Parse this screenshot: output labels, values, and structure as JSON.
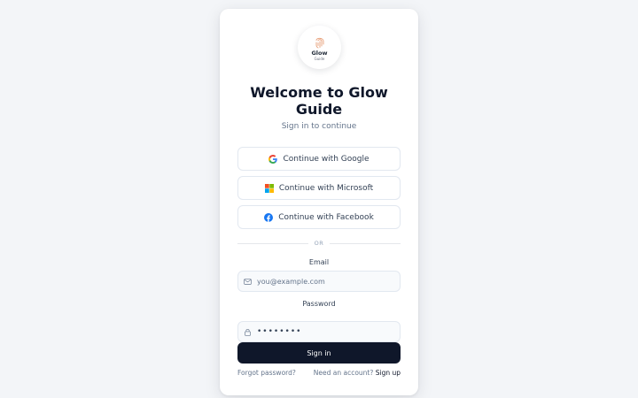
{
  "logo": {
    "title": "Glow",
    "subtitle": "Guide"
  },
  "header": {
    "title": "Welcome to Glow Guide",
    "subtitle": "Sign in to continue"
  },
  "social": {
    "google": "Continue with Google",
    "microsoft": "Continue with Microsoft",
    "facebook": "Continue with Facebook"
  },
  "divider": {
    "text": "OR"
  },
  "form": {
    "email_label": "Email",
    "email_placeholder": "you@example.com",
    "password_label": "Password",
    "password_value": "••••••••",
    "submit_label": "Sign in"
  },
  "footer": {
    "forgot": "Forgot password?",
    "need_account": "Need an account?",
    "signup": "Sign up"
  },
  "colors": {
    "primary": "#0f172a",
    "background": "#f3f5f8",
    "border": "#e2e8f0",
    "muted": "#64748b",
    "logo_accent": "#e8a07a"
  },
  "icons": {
    "logo": "fingerprint-icon",
    "google": "google-icon",
    "microsoft": "microsoft-icon",
    "facebook": "facebook-icon",
    "email": "mail-icon",
    "password": "lock-icon"
  }
}
